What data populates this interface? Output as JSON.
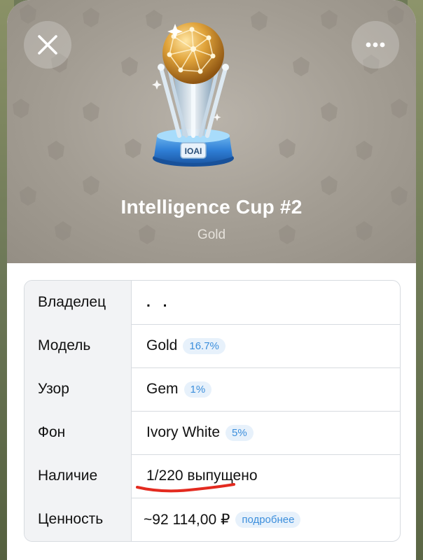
{
  "header": {
    "title": "Intelligence Cup #2",
    "subtitle": "Gold",
    "close_icon": "close-icon",
    "more_icon": "more-icon"
  },
  "gift_image": {
    "icon": "trophy-icon",
    "badge_text": "IOAI"
  },
  "colors": {
    "hero_background": "#a39d93",
    "badge_background": "#e7f1fb",
    "badge_text": "#3d8fdc",
    "underline": "#e32a1f"
  },
  "table": {
    "rows": [
      {
        "label": "Владелец",
        "value": ". ."
      },
      {
        "label": "Модель",
        "value": "Gold",
        "badge": "16.7%"
      },
      {
        "label": "Узор",
        "value": "Gem",
        "badge": "1%"
      },
      {
        "label": "Фон",
        "value": "Ivory White",
        "badge": "5%"
      },
      {
        "label": "Наличие",
        "value": "1/220 выпущено"
      },
      {
        "label": "Ценность",
        "value": "~92 114,00 ₽",
        "badge": "подробнее"
      }
    ]
  }
}
